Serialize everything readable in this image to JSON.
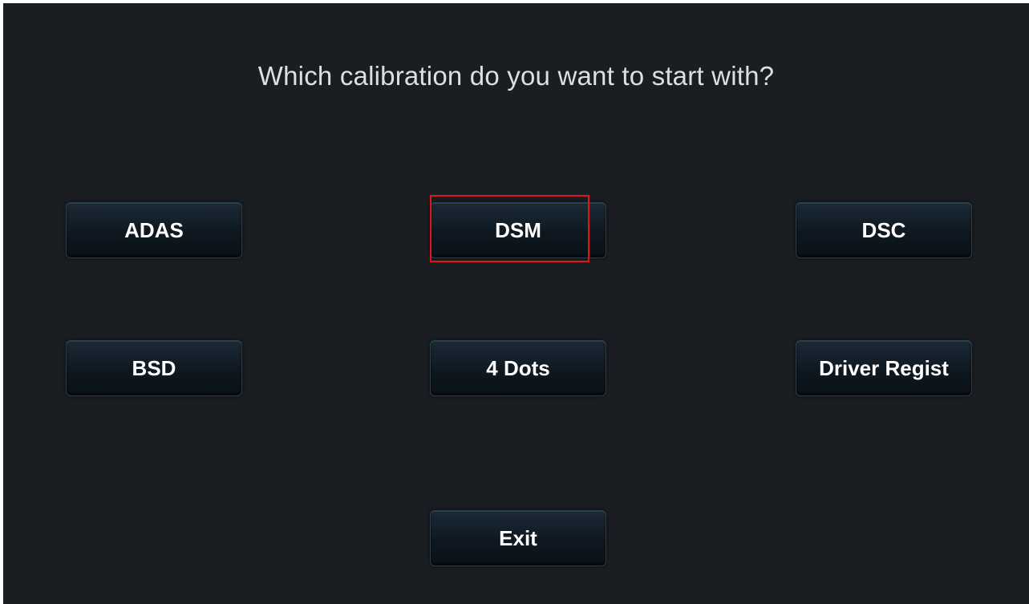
{
  "prompt": {
    "title": "Which calibration do you want to start with?"
  },
  "buttons": {
    "adas": "ADAS",
    "dsm": "DSM",
    "dsc": "DSC",
    "bsd": "BSD",
    "four_dots": "4 Dots",
    "driver_regist": "Driver Regist",
    "exit": "Exit"
  },
  "colors": {
    "background": "#1a1d21",
    "button_face": "#0f1820",
    "text": "#ffffff",
    "highlight": "#e0141b"
  }
}
